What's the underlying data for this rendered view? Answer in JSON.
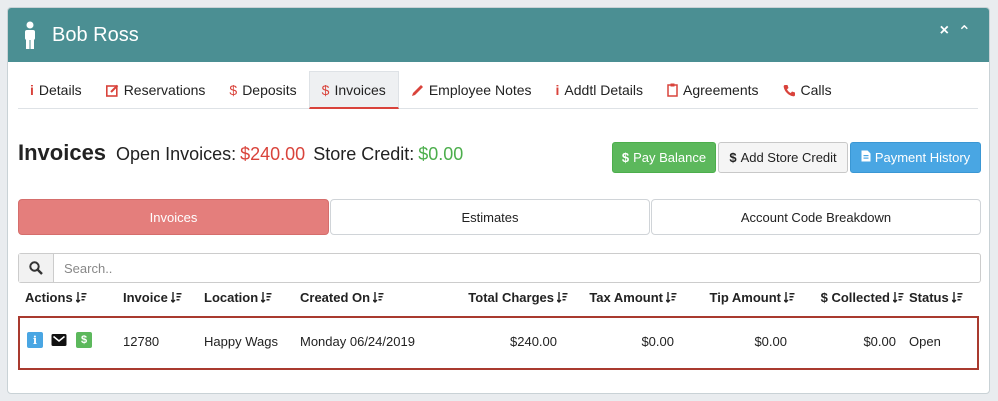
{
  "header": {
    "title": "Bob Ross",
    "close_glyph": "×",
    "collapse_glyph": "⌃"
  },
  "tabs": [
    {
      "label": "Details",
      "icon": "info-icon",
      "glyph": "i"
    },
    {
      "label": "Reservations",
      "icon": "edit-icon",
      "glyph": ""
    },
    {
      "label": "Deposits",
      "icon": "dollar-icon",
      "glyph": "$"
    },
    {
      "label": "Invoices",
      "icon": "dollar-icon",
      "glyph": "$",
      "active": true
    },
    {
      "label": "Employee Notes",
      "icon": "pencil-icon",
      "glyph": ""
    },
    {
      "label": "Addtl Details",
      "icon": "info-icon",
      "glyph": "i"
    },
    {
      "label": "Agreements",
      "icon": "clipboard-icon",
      "glyph": ""
    },
    {
      "label": "Calls",
      "icon": "phone-icon",
      "glyph": ""
    }
  ],
  "summary": {
    "title": "Invoices",
    "open_label": "Open Invoices:",
    "open_value": "$240.00",
    "credit_label": "Store Credit:",
    "credit_value": "$0.00"
  },
  "buttons": {
    "pay_balance": "Pay Balance",
    "add_store_credit": "Add Store Credit",
    "payment_history": "Payment History",
    "dollar_glyph": "$"
  },
  "segments": [
    "Invoices",
    "Estimates",
    "Account Code Breakdown"
  ],
  "active_segment": "Invoices",
  "search": {
    "placeholder": "Search..",
    "value": ""
  },
  "table": {
    "columns": [
      "Actions",
      "Invoice",
      "Location",
      "Created On",
      "Total Charges",
      "Tax Amount",
      "Tip Amount",
      "$ Collected",
      "Status"
    ],
    "rows": [
      {
        "action_info_glyph": "i",
        "action_pay_glyph": "$",
        "invoice": "12780",
        "location": "Happy Wags",
        "created_on": "Monday 06/24/2019",
        "total_charges": "$240.00",
        "tax_amount": "$0.00",
        "tip_amount": "$0.00",
        "collected": "$0.00",
        "status": "Open"
      }
    ]
  },
  "colors": {
    "header": "#4b8f93",
    "accent_red": "#d9433b",
    "green": "#5cb85c",
    "blue": "#49a6e3",
    "segment_active": "#e47e7c",
    "row_highlight": "#a93a2f"
  }
}
